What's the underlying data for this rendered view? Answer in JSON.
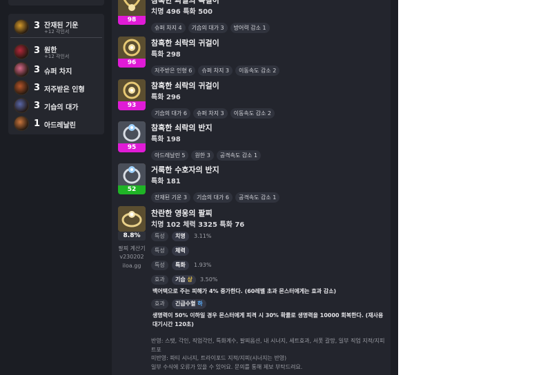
{
  "sidebar": {
    "engravings": [
      {
        "count": "3",
        "name": "잔재된 기운",
        "sub": "+12 각인서",
        "icon": "engraving-remnant-icon",
        "color": "#d49a2c"
      },
      {
        "count": "3",
        "name": "원한",
        "sub": "+12 각인서",
        "icon": "engraving-grudge-icon",
        "color": "#b3283a"
      },
      {
        "count": "3",
        "name": "슈퍼 차지",
        "sub": "",
        "icon": "engraving-super-charge-icon",
        "color": "#d86a8a"
      },
      {
        "count": "3",
        "name": "저주받은 인형",
        "sub": "",
        "icon": "engraving-cursed-doll-icon",
        "color": "#b5562a"
      },
      {
        "count": "3",
        "name": "기습의 대가",
        "sub": "",
        "icon": "engraving-master-ambush-icon",
        "color": "#5967a8"
      },
      {
        "count": "1",
        "name": "아드레날린",
        "sub": "",
        "icon": "engraving-adrenaline-icon",
        "color": "#c9763d"
      }
    ]
  },
  "items": [
    {
      "name": "참혹한 파멸의 목걸이",
      "stats": "치명 496  특화 500",
      "quality": "98",
      "quality_color": "#e01bd6",
      "chips": [
        "슈퍼 차지 4",
        "기습의 대가 3",
        "방어력 감소 1"
      ],
      "icon": "necklace-icon"
    },
    {
      "name": "참혹한 쇠락의 귀걸이",
      "stats": "특화 298",
      "quality": "96",
      "quality_color": "#e01bd6",
      "chips": [
        "저주받은 인형 6",
        "슈퍼 차지 3",
        "이동속도 감소 2"
      ],
      "icon": "earring-icon"
    },
    {
      "name": "참혹한 쇠락의 귀걸이",
      "stats": "특화 296",
      "quality": "93",
      "quality_color": "#e01bd6",
      "chips": [
        "기습의 대가 6",
        "슈퍼 차지 3",
        "이동속도 감소 2"
      ],
      "icon": "earring-icon"
    },
    {
      "name": "참혹한 쇠락의 반지",
      "stats": "특화 198",
      "quality": "95",
      "quality_color": "#e01bd6",
      "chips": [
        "아드레날린 5",
        "원한 3",
        "공격속도 감소 1"
      ],
      "icon": "ring-icon"
    },
    {
      "name": "거룩한 수호자의 반지",
      "stats": "특화 181",
      "quality": "52",
      "quality_color": "#1fb426",
      "chips": [
        "잔재된 기운 3",
        "기습의 대가 6",
        "공격속도 감소 1"
      ],
      "icon": "ring-icon"
    }
  ],
  "bracelet": {
    "name": "찬란한 영웅의 팔찌",
    "stats": "치명 102  체력 3325  특화 76",
    "percent": "8.8%",
    "calc_lines": [
      "팔찌 계산기",
      "v230202",
      "iloa.gg"
    ],
    "rows": [
      {
        "label": "특성",
        "value": "치명",
        "value_suffix": "",
        "pct": "3.11%"
      },
      {
        "label": "특성",
        "value": "체력",
        "value_suffix": "",
        "pct": ""
      },
      {
        "label": "특성",
        "value": "특화",
        "value_suffix": "",
        "pct": "1.93%"
      },
      {
        "label": "효과",
        "value": "기습",
        "value_suffix": "상",
        "pct": "3.50%"
      }
    ],
    "desc1": "백어택으로 주는 피해가 4% 증가한다. (60레벨 초과 몬스터에게는 효과 감소)",
    "effect2": {
      "label": "효과",
      "value": "긴급수혈",
      "value_suffix": "하"
    },
    "desc2_lines": [
      "생명력이 50% 이하일 경우 몬스터에게 피격 시 30% 확률로 생명력을 10000 회복한다. (재사용",
      "대기시간 120초)"
    ],
    "notes": [
      "반영: 스탯, 각인, 직업각인, 특화계수, 팔찌옵션, 내 시너지, 세트효과, 서폿 갈망, 일부 직업 지적/지피",
      "트포",
      "미반영: 파티 시너지, 트라이포드 지적/지피(시너지는 반영)",
      "일부 수식에 오류가 있을 수 있어요. 문의를 통해 제보 부탁드려요."
    ],
    "colors": {
      "suffix_gold": "#e7c34a",
      "suffix_blue": "#5ab0ff"
    }
  }
}
